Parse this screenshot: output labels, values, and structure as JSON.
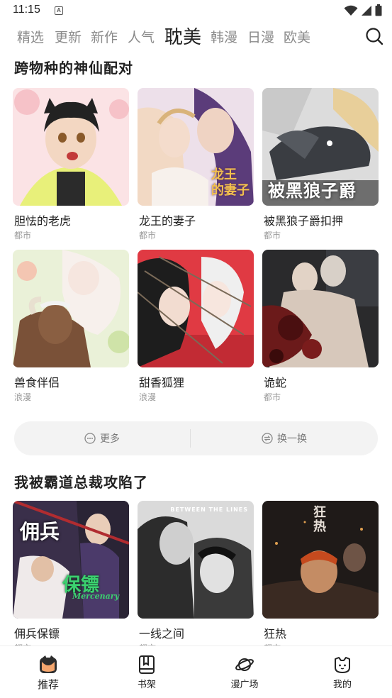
{
  "status_bar": {
    "time": "11:15",
    "notif_glyph": "A"
  },
  "tabs": [
    {
      "label": "精选",
      "active": false
    },
    {
      "label": "更新",
      "active": false
    },
    {
      "label": "新作",
      "active": false
    },
    {
      "label": "人气",
      "active": false
    },
    {
      "label": "耽美",
      "active": true
    },
    {
      "label": "韩漫",
      "active": false
    },
    {
      "label": "日漫",
      "active": false
    },
    {
      "label": "欧美",
      "active": false
    }
  ],
  "section1": {
    "title": "跨物种的神仙配对",
    "cards": [
      {
        "title": "胆怯的老虎",
        "genre": "都市"
      },
      {
        "title": "龙王的妻子",
        "genre": "都市",
        "cover_text": "龙王\n的妻子"
      },
      {
        "title": "被黑狼子爵扣押",
        "genre": "都市",
        "cover_text": "被黑狼子爵"
      },
      {
        "title": "兽食伴侣",
        "genre": "浪漫"
      },
      {
        "title": "甜香狐狸",
        "genre": "浪漫"
      },
      {
        "title": "诡蛇",
        "genre": "都市"
      }
    ]
  },
  "actions": {
    "more": "更多",
    "refresh": "换一换"
  },
  "section2": {
    "title": "我被霸道总裁攻陷了",
    "cards": [
      {
        "title": "佣兵保镖",
        "genre": "都市",
        "cover_text_1": "佣兵",
        "cover_text_2": "保镖",
        "cover_text_3": "Mercenary"
      },
      {
        "title": "一线之间",
        "genre": "都市",
        "cover_text_1": "BETWEEN THE LINES"
      },
      {
        "title": "狂热",
        "genre": "都市",
        "cover_text_1": "狂热"
      }
    ]
  },
  "bottom_nav": [
    {
      "label": "推荐",
      "icon": "fox-face-icon",
      "active": true
    },
    {
      "label": "书架",
      "icon": "bookshelf-icon",
      "active": false
    },
    {
      "label": "漫广场",
      "icon": "planet-icon",
      "active": false
    },
    {
      "label": "我的",
      "icon": "cat-face-icon",
      "active": false
    }
  ],
  "colors": {
    "accent_underline": "#f4a47c",
    "text_primary": "#222222",
    "text_muted": "#8a8a8a"
  }
}
